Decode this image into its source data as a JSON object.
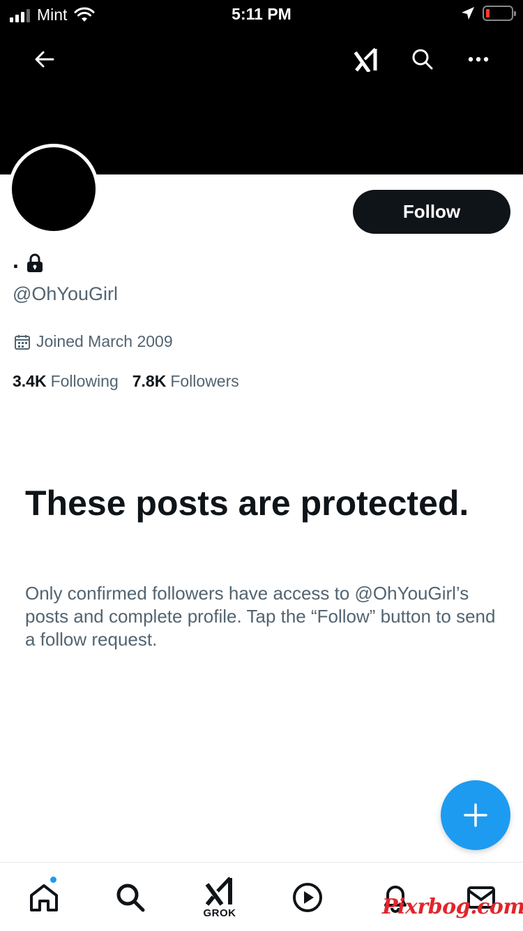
{
  "status_bar": {
    "carrier": "Mint",
    "time": "5:11 PM"
  },
  "profile": {
    "display_name": ".",
    "handle": "@OhYouGirl",
    "joined": "Joined March 2009",
    "following_count": "3.4K",
    "following_label": "Following",
    "followers_count": "7.8K",
    "followers_label": "Followers",
    "follow_button_label": "Follow"
  },
  "protected": {
    "title": "These posts are protected.",
    "message": "Only confirmed followers have access to @OhYouGirl’s posts and complete profile. Tap the “Follow” button to send a follow request."
  },
  "tab_bar": {
    "grok_label": "GROK"
  },
  "watermark": "Pixrbog.com",
  "icons": {
    "nav": [
      "back-arrow-icon",
      "grok-icon",
      "search-icon",
      "more-icon"
    ],
    "tabs": [
      "home-icon",
      "search-icon",
      "grok-icon",
      "video-icon",
      "notifications-icon",
      "messages-icon"
    ]
  },
  "colors": {
    "accent": "#1d9bf0",
    "primary_text": "#0f1419",
    "secondary_text": "#536471",
    "battery_low": "#ff3b30"
  }
}
